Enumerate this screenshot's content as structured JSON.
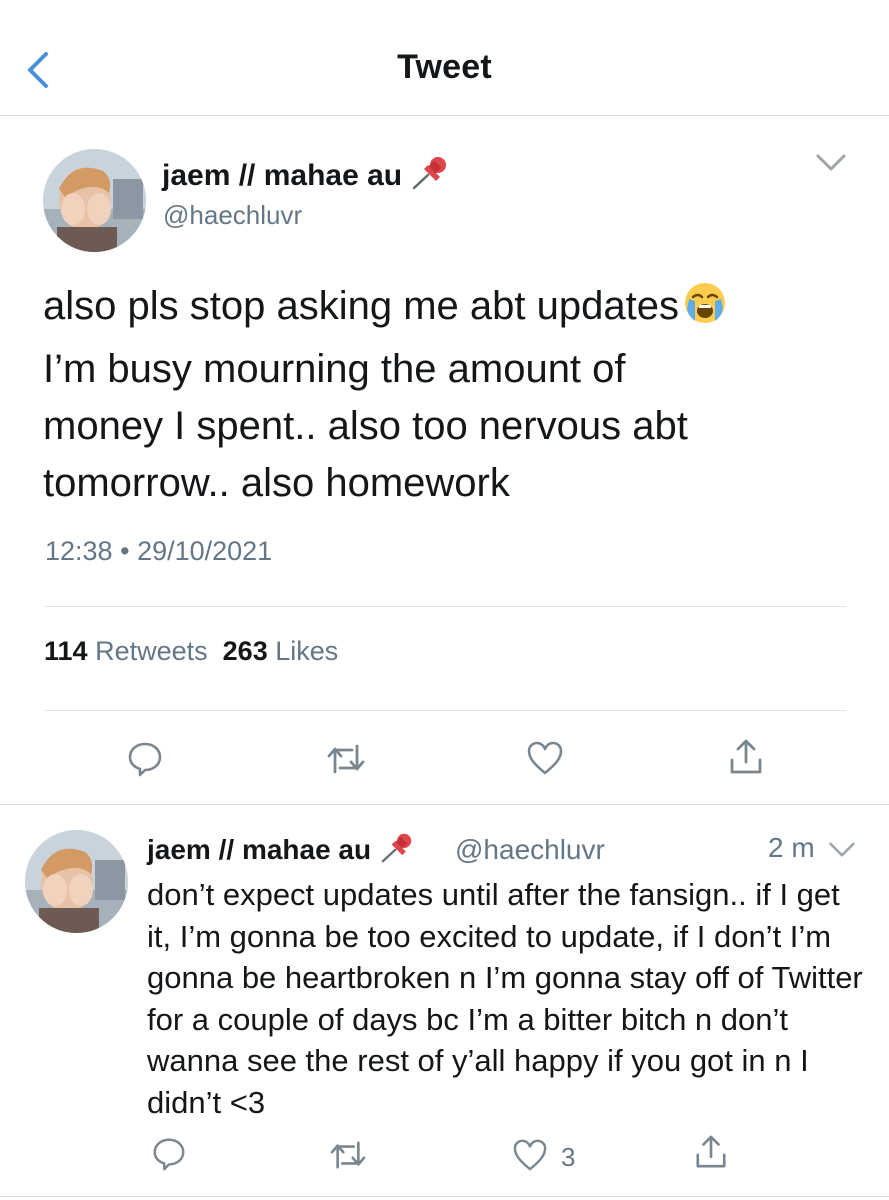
{
  "nav": {
    "title": "Tweet"
  },
  "tweet": {
    "author_name": "jaem // mahae au",
    "handle": "@haechluvr",
    "text_line1": "also pls stop asking me abt updates",
    "text_rest": "I’m busy mourning the amount of\nmoney I spent.. also too nervous abt\ntomorrow.. also homework",
    "time": "12:38",
    "separator": "•",
    "date": "29/10/2021",
    "retweets_count": "114",
    "retweets_label": "Retweets",
    "likes_count": "263",
    "likes_label": "Likes"
  },
  "reply": {
    "author_name": "jaem // mahae au",
    "handle": "@haechluvr",
    "time": "2 m",
    "text": "don’t expect updates until after the fansign.. if I get it, I’m gonna be too excited to update, if I don’t I’m gonna be heartbroken n I’m gonna stay off of Twitter for a couple of days bc I’m a bitter bitch n don’t wanna see the rest of y’all happy if you got in n I didn’t <3",
    "like_count": "3"
  },
  "colors": {
    "accent": "#1da1f2",
    "back_arrow": "#4a90d9",
    "secondary_text": "#657786",
    "icon_gray": "#7a8791",
    "divider": "#e1e5e9"
  },
  "icons": {
    "back": "chevron-left-icon",
    "pin": "pushpin-icon",
    "emoji": "loudly-crying-face-emoji",
    "menu": "chevron-down-icon",
    "reply": "reply-bubble-icon",
    "retweet": "retweet-icon",
    "like": "heart-icon",
    "share": "share-icon"
  }
}
